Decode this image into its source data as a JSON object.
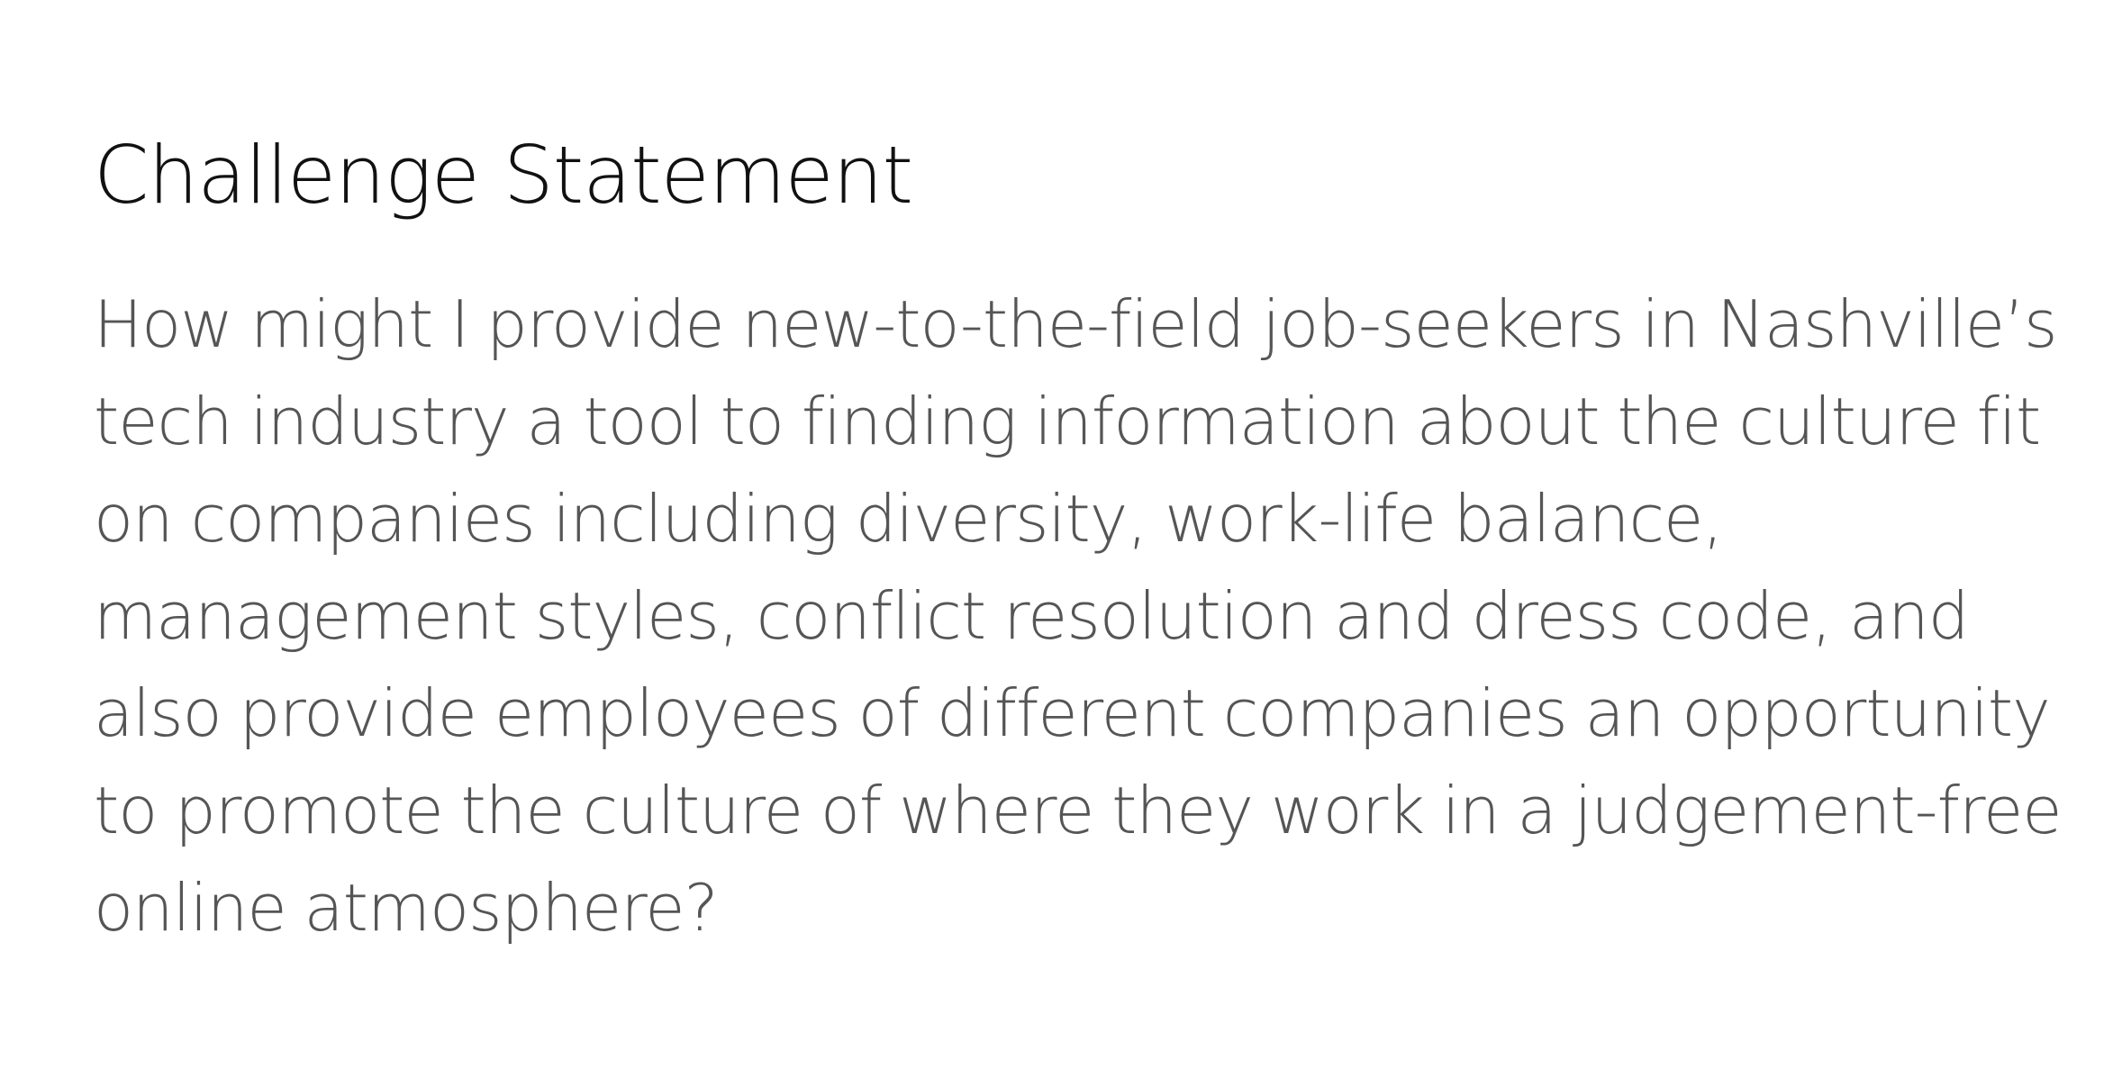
{
  "document": {
    "heading": "Challenge Statement",
    "body": "How might I provide new-to-the-field job-seekers in Nashville’s tech industry a tool to finding information about the culture fit on companies including diversity, work-life balance, management styles, conflict resolution and dress code, and also provide employees of different companies an opportunity to promote the culture of where they work in a judgement-free online atmosphere?"
  }
}
